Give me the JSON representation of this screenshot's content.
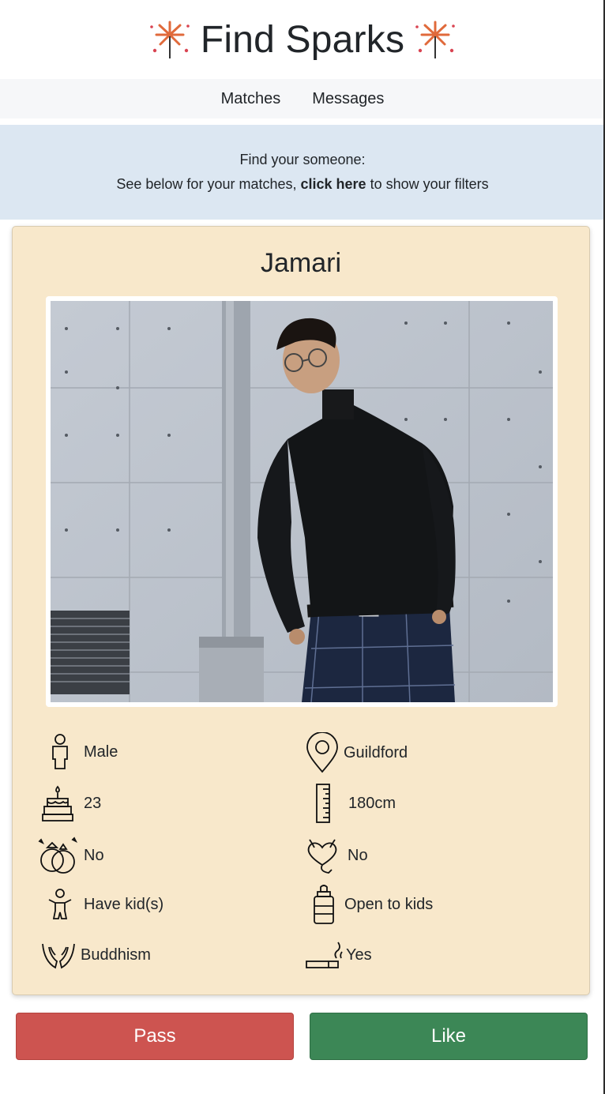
{
  "app": {
    "title": "Find Sparks"
  },
  "nav": {
    "items": [
      "Matches",
      "Messages"
    ]
  },
  "banner": {
    "line1": "Find your someone:",
    "line2_prefix": "See below for your matches, ",
    "line2_link": "click here",
    "line2_suffix": " to show your filters"
  },
  "profile": {
    "name": "Jamari",
    "photo_alt": "Profile photo",
    "details": {
      "gender": "Male",
      "location": "Guildford",
      "age": "23",
      "height": "180cm",
      "married": "No",
      "relationship": "No",
      "kids": "Have kid(s)",
      "open_to_kids": "Open to kids",
      "religion": "Buddhism",
      "smoking": "Yes"
    }
  },
  "actions": {
    "pass": "Pass",
    "like": "Like"
  },
  "colors": {
    "card": "#f8e8cb",
    "banner": "#dce7f2",
    "pass": "#cd5450",
    "like": "#3c8756",
    "spark": "#e06a3b"
  }
}
